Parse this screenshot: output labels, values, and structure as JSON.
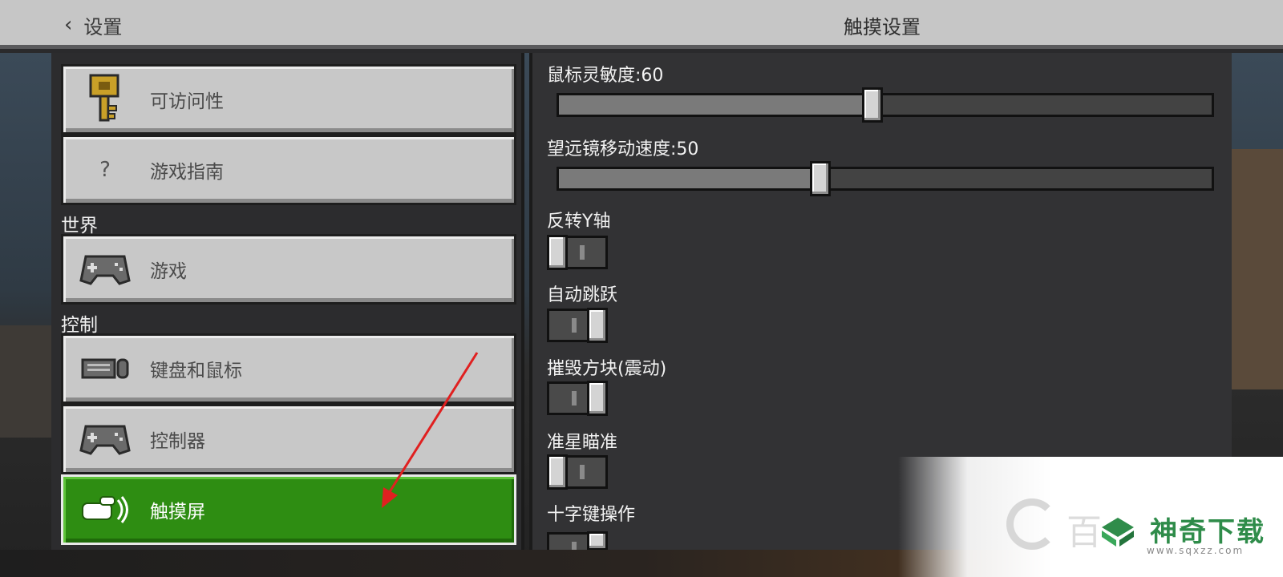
{
  "header": {
    "back_label": "设置",
    "title": "触摸设置"
  },
  "sidebar": {
    "items_top": [
      {
        "label": "可访问性",
        "icon": "key-icon"
      },
      {
        "label": "游戏指南",
        "icon": "question-icon",
        "glyph": "?"
      }
    ],
    "section_world": "世界",
    "items_world": [
      {
        "label": "游戏",
        "icon": "gamepad-icon"
      }
    ],
    "section_control": "控制",
    "items_control": [
      {
        "label": "键盘和鼠标",
        "icon": "keyboard-mouse-icon"
      },
      {
        "label": "控制器",
        "icon": "gamepad-icon"
      },
      {
        "label": "触摸屏",
        "icon": "touch-hand-icon",
        "active": true
      }
    ]
  },
  "settings": {
    "mouse_sensitivity": {
      "label": "鼠标灵敏度:60",
      "value": 60,
      "max": 100
    },
    "telescope_speed": {
      "label": "望远镜移动速度:50",
      "value": 50,
      "max": 100
    },
    "invert_y": {
      "label": "反转Y轴",
      "on": false
    },
    "auto_jump": {
      "label": "自动跳跃",
      "on": true
    },
    "break_vibration": {
      "label": "摧毁方块(震动)",
      "on": true
    },
    "crosshair_aim": {
      "label": "准星瞄准",
      "on": false
    },
    "dpad": {
      "label": "十字键操作",
      "on": true
    }
  },
  "watermark": {
    "brand": "神奇下载",
    "partial_text": "百",
    "url": "www.sqxzz.com"
  },
  "colors": {
    "active_green": "#2e8d12",
    "button_gray": "#c8c8c8",
    "annotation_red": "#e02020",
    "brand_green": "#2f8c4a"
  }
}
